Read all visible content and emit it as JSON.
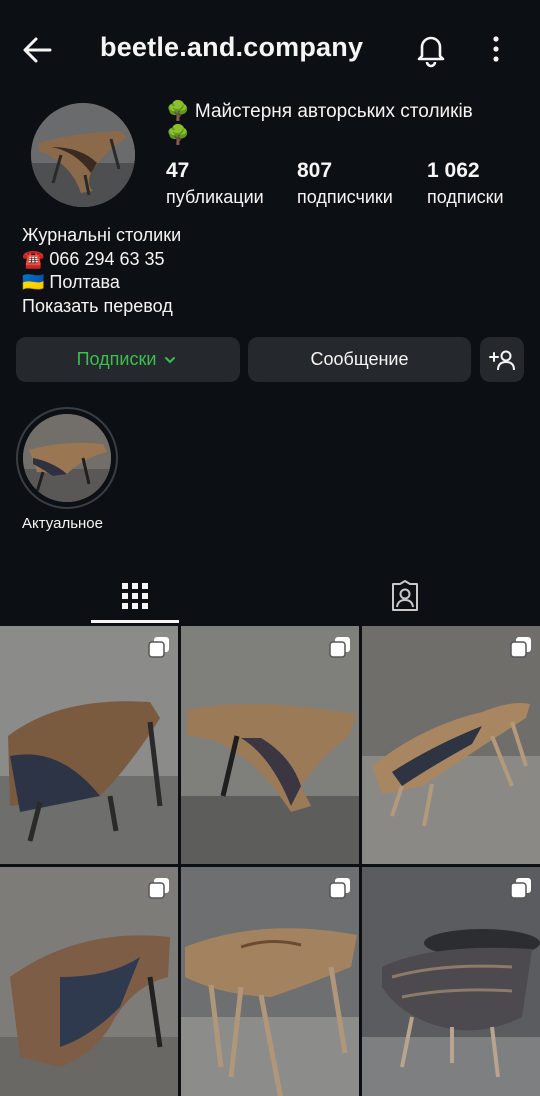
{
  "header": {
    "username": "beetle.and.company",
    "back_icon": "arrow-left-icon",
    "bell_icon": "bell-icon",
    "more_icon": "more-vertical-icon"
  },
  "profile": {
    "name_line1": "🌳 Майстерня авторських столиків",
    "name_line2": "🌳",
    "stats": [
      {
        "value": "47",
        "label": "публикации"
      },
      {
        "value": "807",
        "label": "подписчики"
      },
      {
        "value": "1 062",
        "label": "подписки"
      }
    ],
    "bio": [
      "Журнальні столики",
      "☎️ 066 294 63 35",
      "🇺🇦 Полтава",
      "Показать перевод"
    ]
  },
  "actions": {
    "follow_label": "Подписки",
    "follow_color": "#3bbf4f",
    "message_label": "Сообщение",
    "add_icon": "add-person-icon"
  },
  "highlight": {
    "label": "Актуальное"
  },
  "tabs": [
    {
      "icon": "grid-icon",
      "active": true
    },
    {
      "icon": "tagged-icon",
      "active": false
    }
  ],
  "posts": [
    {
      "type": "multi",
      "icon": "carousel-icon"
    },
    {
      "type": "multi",
      "icon": "carousel-icon"
    },
    {
      "type": "multi",
      "icon": "carousel-icon"
    },
    {
      "type": "multi",
      "icon": "carousel-icon"
    },
    {
      "type": "multi",
      "icon": "carousel-icon"
    },
    {
      "type": "multi",
      "icon": "carousel-icon"
    }
  ]
}
